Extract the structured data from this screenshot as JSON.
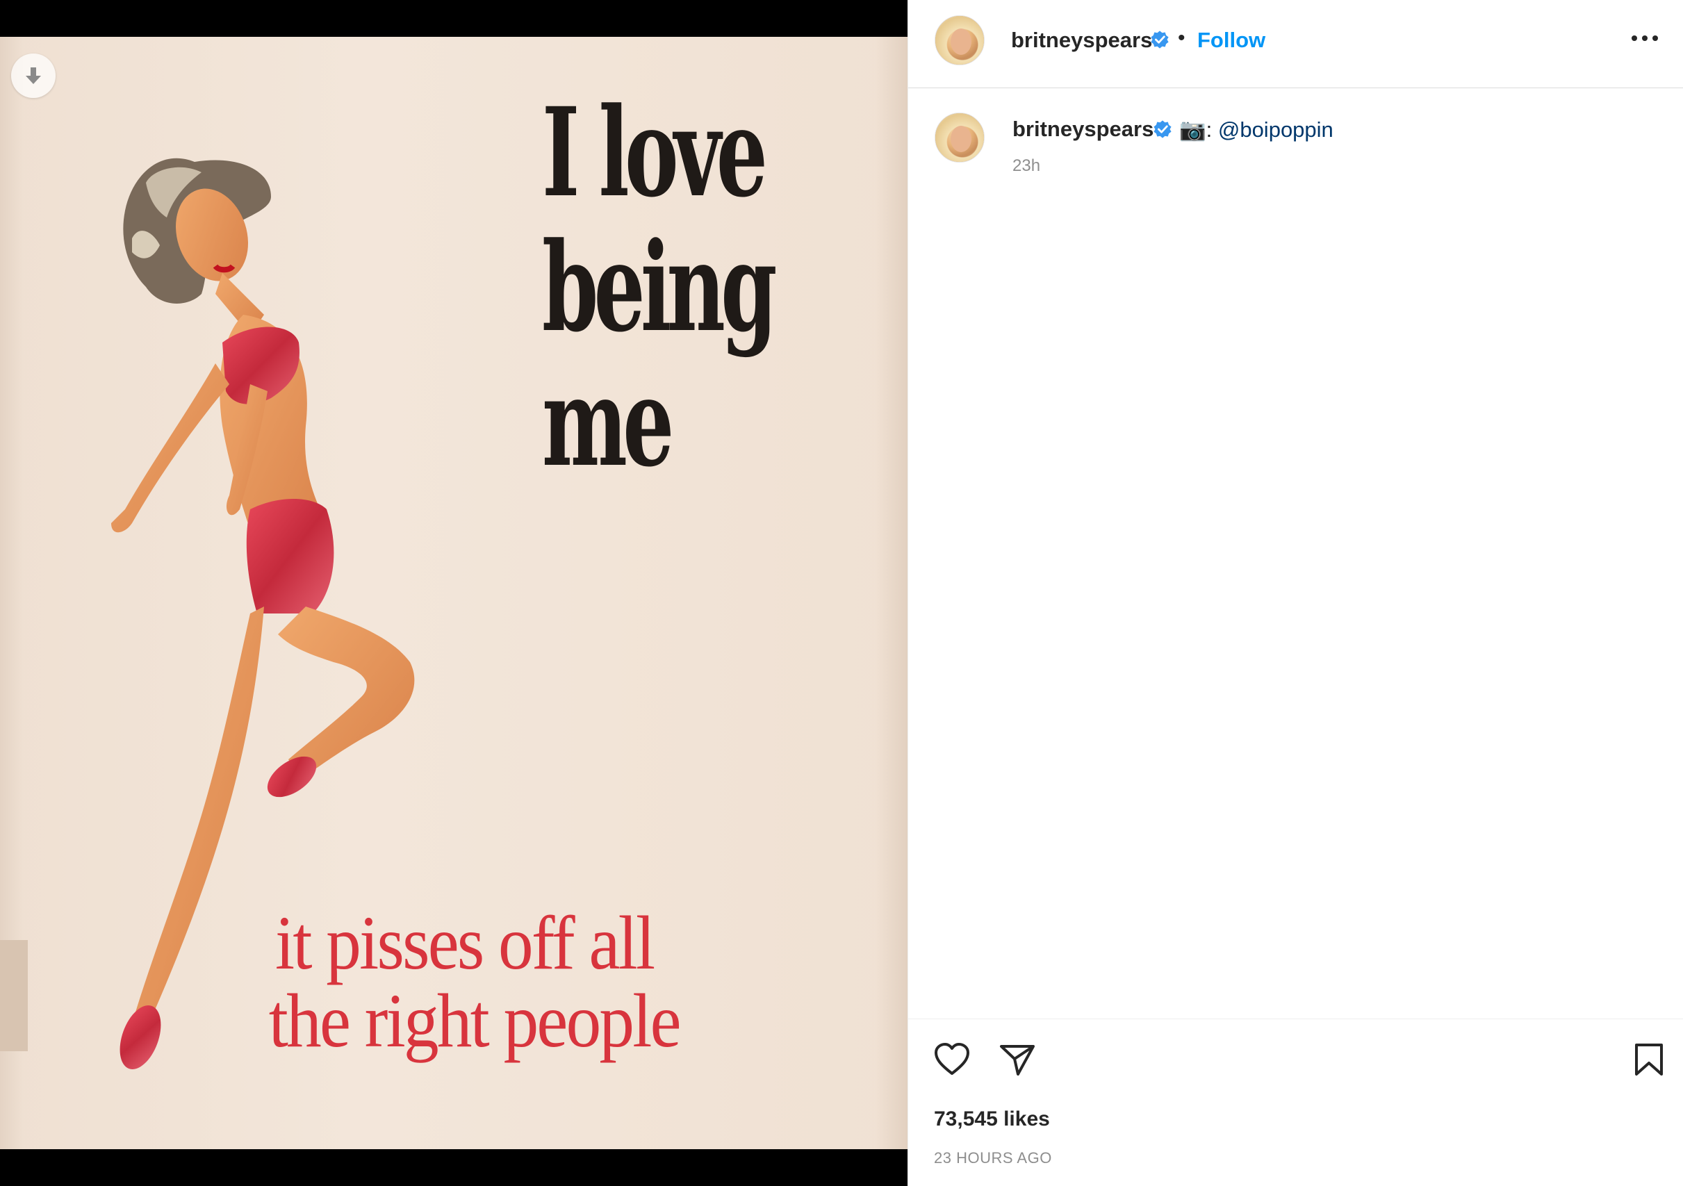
{
  "post": {
    "author": "britneyspears",
    "follow_label": "Follow",
    "separator": "•",
    "caption_emoji": "📷",
    "caption_suffix": ":",
    "caption_mention": "@boipoppin",
    "caption_time": "23h",
    "likes": "73,545 likes",
    "posted_ago": "23 HOURS AGO"
  },
  "poster": {
    "headline_line1": "I love",
    "headline_line2": "being",
    "headline_line3": "me",
    "subline_line1": "it pisses off all",
    "subline_line2": "the right people"
  },
  "icons": {
    "download": "download-icon",
    "verified": "verified-badge-icon",
    "more": "more-options-icon",
    "like": "heart-icon",
    "share": "share-icon",
    "save": "bookmark-icon"
  },
  "colors": {
    "follow": "#0095f6",
    "verified": "#3897f0",
    "mention": "#00376b",
    "poster_red": "#d8343d"
  }
}
